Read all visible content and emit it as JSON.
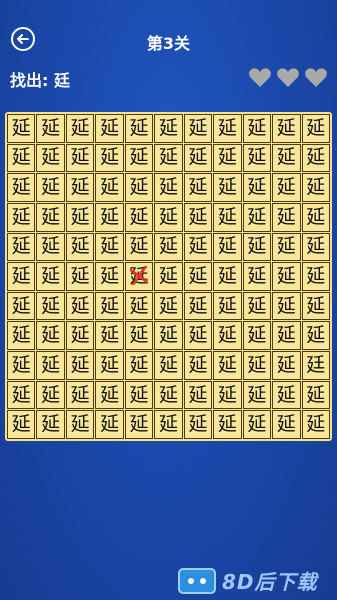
{
  "header": {
    "title": "第3关",
    "back_icon": "arrow-left-icon"
  },
  "prompt": {
    "text": "找出: 廷"
  },
  "lives": {
    "icon": "heart-icon",
    "count": 3,
    "color": "#a9a9a9"
  },
  "board": {
    "rows": 11,
    "cols": 11,
    "default_char": "延",
    "cells": [
      [
        "延",
        "延",
        "延",
        "延",
        "延",
        "延",
        "延",
        "延",
        "延",
        "延",
        "延"
      ],
      [
        "延",
        "延",
        "延",
        "延",
        "延",
        "延",
        "延",
        "延",
        "延",
        "延",
        "延"
      ],
      [
        "延",
        "延",
        "延",
        "延",
        "延",
        "延",
        "延",
        "延",
        "延",
        "延",
        "延"
      ],
      [
        "延",
        "延",
        "延",
        "延",
        "延",
        "延",
        "延",
        "延",
        "延",
        "延",
        "延"
      ],
      [
        "延",
        "延",
        "延",
        "延",
        "延",
        "延",
        "延",
        "延",
        "延",
        "延",
        "延"
      ],
      [
        "延",
        "延",
        "延",
        "延",
        "延",
        "延",
        "延",
        "延",
        "延",
        "延",
        "延"
      ],
      [
        "延",
        "延",
        "延",
        "延",
        "延",
        "延",
        "延",
        "延",
        "延",
        "延",
        "延"
      ],
      [
        "延",
        "延",
        "延",
        "延",
        "延",
        "延",
        "延",
        "延",
        "延",
        "延",
        "延"
      ],
      [
        "延",
        "延",
        "延",
        "延",
        "延",
        "延",
        "延",
        "延",
        "延",
        "延",
        "廷"
      ],
      [
        "延",
        "延",
        "延",
        "延",
        "延",
        "延",
        "延",
        "延",
        "延",
        "延",
        "延"
      ],
      [
        "延",
        "延",
        "延",
        "延",
        "延",
        "延",
        "延",
        "延",
        "延",
        "延",
        "延"
      ]
    ],
    "marked_cell": {
      "row": 5,
      "col": 4
    },
    "colors": {
      "tile": "#f8e79a",
      "board": "#f5e28d",
      "mark": "#e0311f"
    }
  },
  "watermark": {
    "text": "8D后下载"
  }
}
